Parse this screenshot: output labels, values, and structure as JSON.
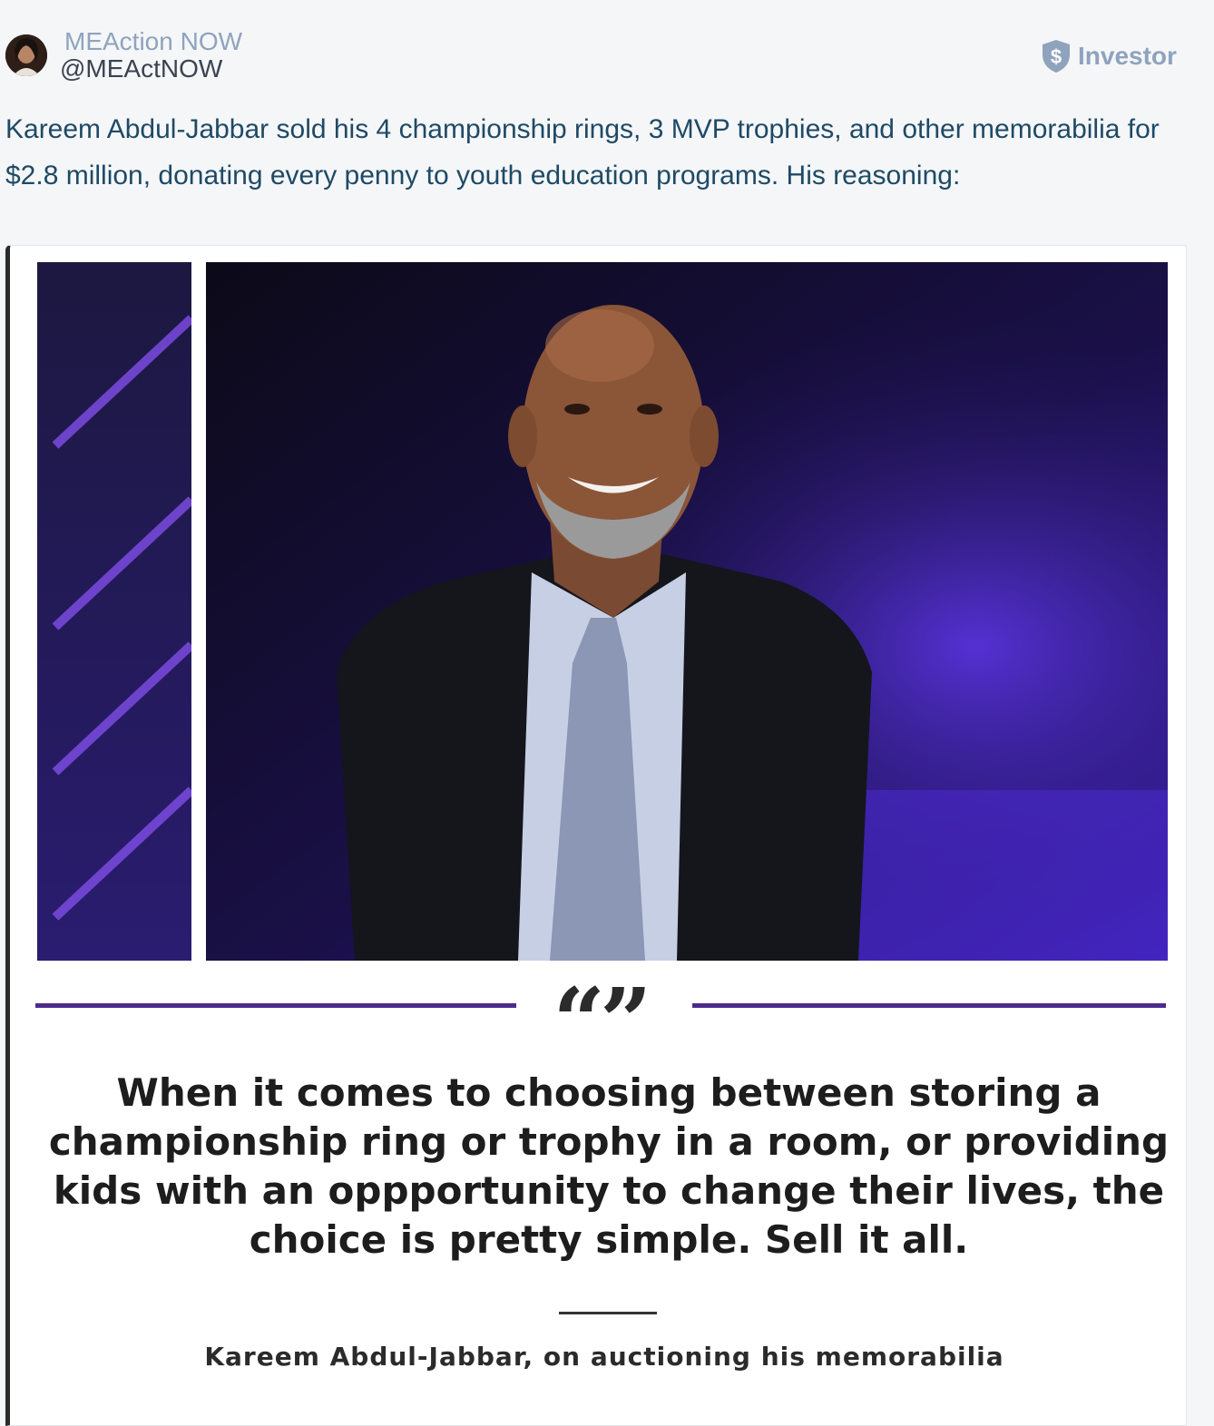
{
  "author": {
    "name": "MEAction NOW",
    "handle": "@MEActNOW",
    "badge_label": "Investor",
    "badge_icon": "shield-dollar-icon"
  },
  "tweet": {
    "text": "Kareem Abdul-Jabbar sold his 4 championship rings, 3 MVP trophies, and other memorabilia for $2.8 million, donating every penny to youth education programs. His reasoning:"
  },
  "card": {
    "quote_marks": "“”",
    "quote": "When it comes to choosing between storing a championship ring or trophy in a room, or providing kids with an oppportunity to change their lives, the choice is pretty simple. Sell it all.",
    "attribution": "Kareem Abdul-Jabbar, on auctioning his memorabilia"
  },
  "colors": {
    "name": "#8fa3bd",
    "tweet_text": "#1e4a66",
    "divider": "#4b2a8c"
  }
}
